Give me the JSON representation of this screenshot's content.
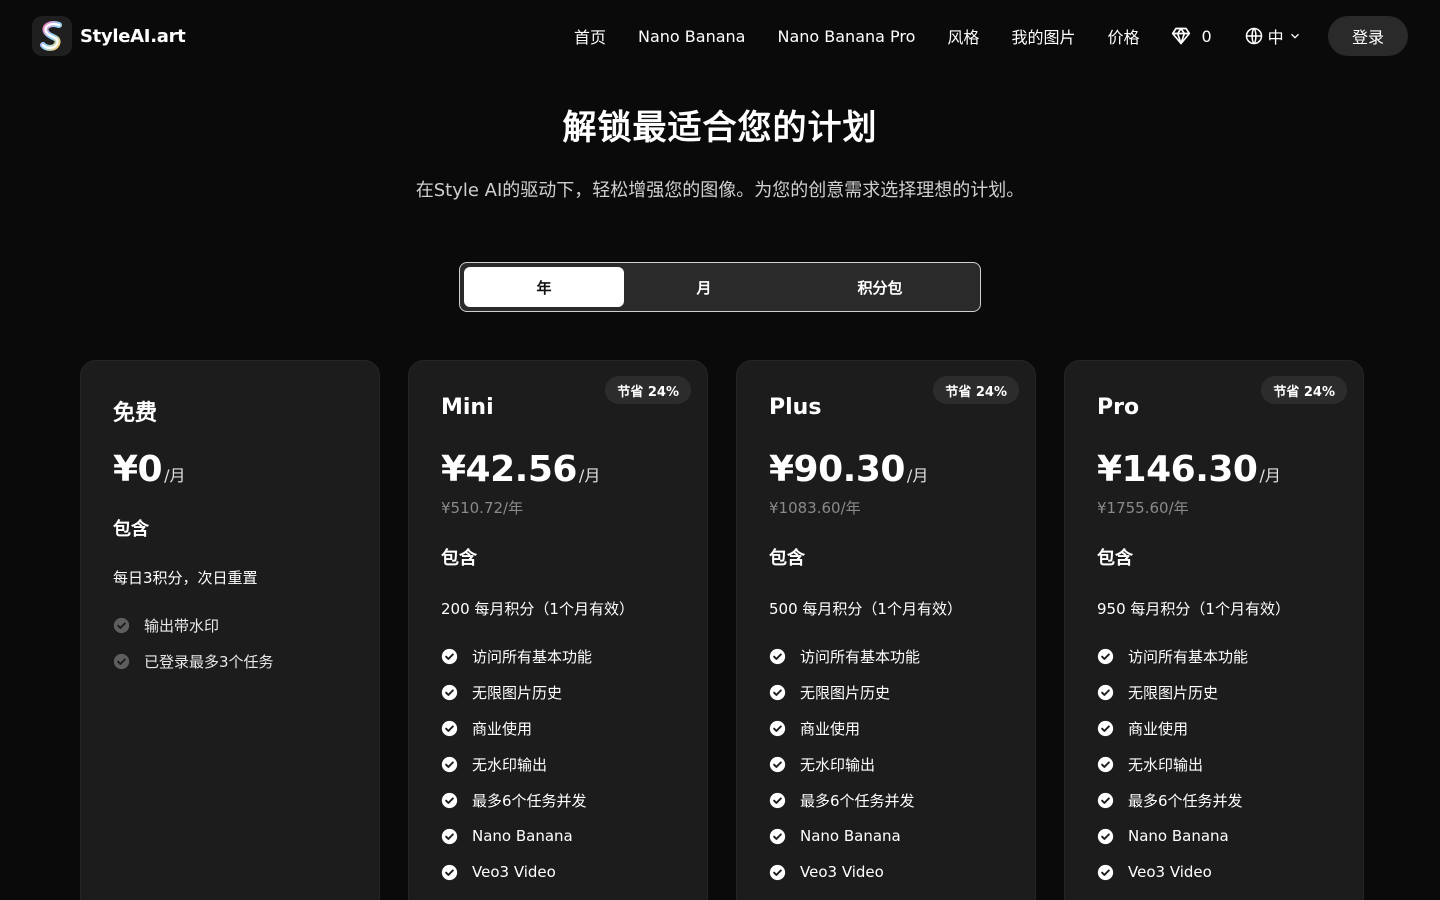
{
  "brand": {
    "name": "StyleAI.art"
  },
  "nav": {
    "items": [
      "首页",
      "Nano Banana",
      "Nano Banana Pro",
      "风格",
      "我的图片",
      "价格"
    ],
    "credits": "0",
    "lang": "中",
    "login": "登录"
  },
  "hero": {
    "title": "解锁最适合您的计划",
    "subtitle": "在Style AI的驱动下，轻松增强您的图像。为您的创意需求选择理想的计划。"
  },
  "tabs": {
    "yearly": "年",
    "monthly": "月",
    "packs": "积分包",
    "active": "yearly"
  },
  "plans": [
    {
      "name": "免费",
      "price": "¥0",
      "unit": "/月",
      "includes": "包含",
      "credits": "每日3积分，次日重置",
      "features": [
        "输出带水印",
        "已登录最多3个任务"
      ]
    },
    {
      "name": "Mini",
      "badge": "节省 24%",
      "price": "¥42.56",
      "unit": "/月",
      "yearly": "¥510.72/年",
      "includes": "包含",
      "credits": "200 每月积分（1个月有效）",
      "features": [
        "访问所有基本功能",
        "无限图片历史",
        "商业使用",
        "无水印输出",
        "最多6个任务并发",
        "Nano Banana",
        "Veo3 Video"
      ]
    },
    {
      "name": "Plus",
      "badge": "节省 24%",
      "price": "¥90.30",
      "unit": "/月",
      "yearly": "¥1083.60/年",
      "includes": "包含",
      "credits": "500 每月积分（1个月有效）",
      "features": [
        "访问所有基本功能",
        "无限图片历史",
        "商业使用",
        "无水印输出",
        "最多6个任务并发",
        "Nano Banana",
        "Veo3 Video"
      ]
    },
    {
      "name": "Pro",
      "badge": "节省 24%",
      "price": "¥146.30",
      "unit": "/月",
      "yearly": "¥1755.60/年",
      "includes": "包含",
      "credits": "950 每月积分（1个月有效）",
      "features": [
        "访问所有基本功能",
        "无限图片历史",
        "商业使用",
        "无水印输出",
        "最多6个任务并发",
        "Nano Banana",
        "Veo3 Video"
      ]
    }
  ],
  "colors": {
    "background": "#0a0a0a",
    "card": "#1c1c1c",
    "badge": "#2c2c2c",
    "muted_check": "#6a6a6a"
  }
}
